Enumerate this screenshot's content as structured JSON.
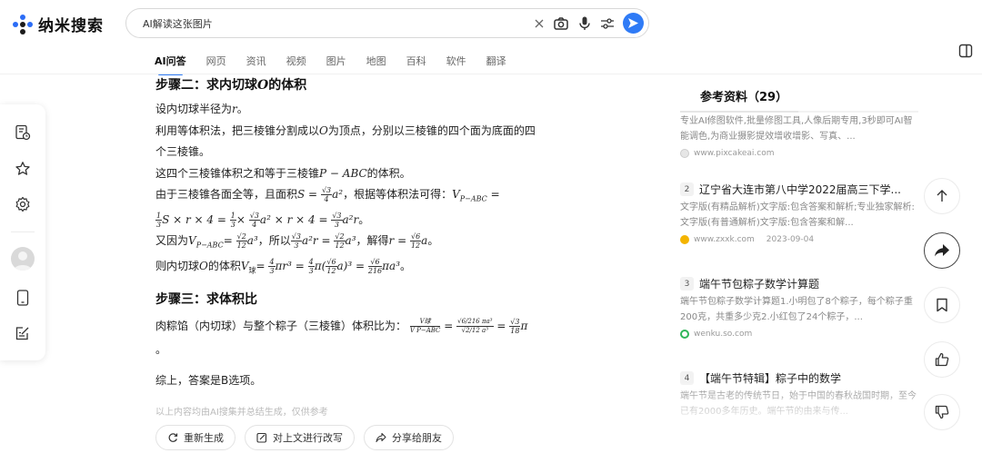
{
  "header": {
    "logo_text": "纳米搜索",
    "search_value": "AI解读这张图片",
    "brand_color": "#2f7bf6"
  },
  "tabs": [
    {
      "label": "AI问答",
      "active": true
    },
    {
      "label": "网页"
    },
    {
      "label": "资讯"
    },
    {
      "label": "视频"
    },
    {
      "label": "图片"
    },
    {
      "label": "地图"
    },
    {
      "label": "百科"
    },
    {
      "label": "软件"
    },
    {
      "label": "翻译"
    }
  ],
  "answer": {
    "step2_title": "步骤二：求内切球",
    "step2_title_var": "O",
    "step2_title_tail": "的体积",
    "l1": "设内切球半径为",
    "l1_var": "r",
    "l1_tail": "。",
    "l2a": "利用等体积法，把三棱锥分割成以",
    "l2_var": "O",
    "l2b": "为顶点，分别以三棱锥的四个面为底面的四",
    "l2c": "个三棱锥。",
    "l3a": "这四个三棱锥体积之和等于三棱锥",
    "l3_var": "P − ABC",
    "l3b": "的体积。",
    "l4a": "由于三棱锥各面全等，且面积",
    "l4_math1": "S =",
    "l4_f1_num": "√3",
    "l4_f1_den": "4",
    "l4_math2": "a²",
    "l4b": "，根据等体积法可得：",
    "l4_math3": "V",
    "l4_sub": "P−ABC",
    "l4_math4": "=",
    "l5_f1_num": "1",
    "l5_f1_den": "3",
    "l5_m1": "S × r × 4 =",
    "l5_f2_num": "1",
    "l5_f2_den": "3",
    "l5_m2": "×",
    "l5_f3_num": "√3",
    "l5_f3_den": "4",
    "l5_m3": "a² × r × 4 =",
    "l5_f4_num": "√3",
    "l5_f4_den": "3",
    "l5_m4": "a²r",
    "l5_tail": "。",
    "l6a": "又因为",
    "l6_m1": "V",
    "l6_sub": "P−ABC",
    "l6_m2": "=",
    "l6_f1_num": "√2",
    "l6_f1_den": "12",
    "l6_m3": "a³",
    "l6b": "，所以",
    "l6_f2_num": "√3",
    "l6_f2_den": "3",
    "l6_m4": "a²r =",
    "l6_f3_num": "√2",
    "l6_f3_den": "12",
    "l6_m5": "a³",
    "l6c": "，解得",
    "l6_m6": "r =",
    "l6_f4_num": "√6",
    "l6_f4_den": "12",
    "l6_m7": "a",
    "l6_tail": "。",
    "l7a": "则内切球",
    "l7_var": "O",
    "l7b": "的体积",
    "l7_m1": "V",
    "l7_sub": "球",
    "l7_m2": "=",
    "l7_f1_num": "4",
    "l7_f1_den": "3",
    "l7_m3": "πr³ =",
    "l7_f2_num": "4",
    "l7_f2_den": "3",
    "l7_m4": "π(",
    "l7_f3_num": "√6",
    "l7_f3_den": "12",
    "l7_m5": "a)³ =",
    "l7_f4_num": "√6",
    "l7_f4_den": "216",
    "l7_m6": "πa³",
    "l7_tail": "。",
    "step3_title": "步骤三：求体积比",
    "l8a": "肉粽馅（内切球）与整个粽子（三棱锥）体积比为：",
    "l8_f1_num": "V球",
    "l8_f1_den": "V P−ABC",
    "l8_m1": "=",
    "l8_f2_num": "√6/216 πa³",
    "l8_f2_den": "√2/12 a³",
    "l8_m2": "=",
    "l8_f3_num": "√3",
    "l8_f3_den": "18",
    "l8_m3": "π",
    "l9": "。",
    "conclusion": "综上，答案是B选项。",
    "disclaimer": "以上内容均由AI搜集并总结生成，仅供参考"
  },
  "actions": {
    "regenerate": "重新生成",
    "rewrite": "对上文进行改写",
    "share": "分享给朋友"
  },
  "references": {
    "title": "参考资料（29）",
    "items": [
      {
        "snippet": "专业AI修图软件,批量修图工具,人像后期专用,3秒即可AI智能调色,为商业摄影提效增收增影、写真、...",
        "source": "www.pixcakeai.com",
        "date": ""
      },
      {
        "num": "2",
        "title": "辽宁省大连市第八中学2022届高三下学...",
        "snippet": "文字版(有精品解析)文字版:包含答案和解析;专业独家解析: 文字版(有普通解析)文字版:包含答案和解...",
        "source": "www.zxxk.com",
        "date": "2023-09-04"
      },
      {
        "num": "3",
        "title": "端午节包粽子数学计算题",
        "snippet": "端午节包粽子数学计算题1.小明包了8个粽子，每个粽子重200克，共重多少克2.小红包了24个粽子，...",
        "source": "wenku.so.com",
        "date": ""
      },
      {
        "num": "4",
        "title": "【端午节特辑】粽子中的数学",
        "snippet": "端午节是古老的传统节日，始于中国的春秋战国时期，至今已有2000多年历史。端午节的由来与传..."
      }
    ]
  }
}
